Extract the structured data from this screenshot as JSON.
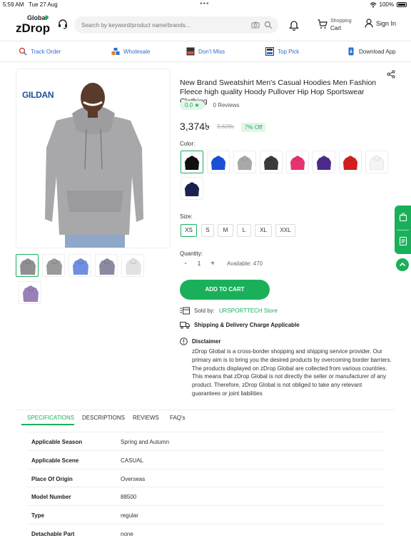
{
  "status_bar": {
    "time": "5:59 AM",
    "date": "Tue 27 Aug",
    "battery": "100%"
  },
  "header": {
    "logo_top": "Global",
    "logo_main": "zDrop",
    "search_placeholder": "Search by keyword/product name/brands...",
    "cart_line1": "Shopping",
    "cart_line2": "Cart",
    "signin": "Sign In"
  },
  "nav": [
    {
      "label": "Track Order",
      "icon": "track-order-icon"
    },
    {
      "label": "Wholesale",
      "icon": "wholesale-icon"
    },
    {
      "label": "Don't Miss",
      "icon": "best-price-icon"
    },
    {
      "label": "Top Pick",
      "icon": "top-pick-icon"
    },
    {
      "label": "Download App",
      "icon": "download-app-icon"
    }
  ],
  "product": {
    "brand_logo": "GILDAN",
    "title": "New Brand Sweatshirt Men's Casual Hoodies Men Fashion Fleece high quality Hoody Pullover Hip Hop Sportswear Clothing",
    "rating": "0.0",
    "reviews": "0 Reviews",
    "price": "3,374৳",
    "old_price": "3,628৳",
    "discount": "7% Off",
    "color_label": "Color:",
    "colors": [
      "#111111",
      "#1b4fd8",
      "#a9a9a9",
      "#3a3a3c",
      "#e8336e",
      "#4a2b8c",
      "#d21f1f",
      "#f4f4f4",
      "#1c2150"
    ],
    "size_label": "Size:",
    "sizes": [
      "XS",
      "S",
      "M",
      "L",
      "XL",
      "XXL"
    ],
    "selected_size": "XS",
    "quantity_label": "Quantity:",
    "quantity": "1",
    "minus": "-",
    "plus": "+",
    "available": "Available: 470",
    "add_to_cart": "ADD TO CART",
    "sold_by_label": "Sold by:",
    "store": "URSPORTTECH Store",
    "shipping": "Shipping & Delivery Charge Applicable",
    "disclaimer_title": "Disclaimer",
    "disclaimer_body": "zDrop Global is a cross-border shopping and shipping service provider. Our primary aim is to bring you the desired products by overcoming border barriers. The products displayed on zDrop Global are collected from various countries. This means that zDrop Global is not directly the seller or manufacturer of any product. Therefore, zDrop Global is not obliged to take any relevant guarantees or joint liabilities",
    "thumbnail_colors": [
      "#8f8f92",
      "#9a9a9a",
      "#6f8fe0",
      "#8a8aa0",
      "#e2e2e2",
      "#9a7fb8"
    ]
  },
  "tabs": [
    "SPECIFICATIONS",
    "DESCRIPTIONS",
    "REVIEWS",
    "FAQ's"
  ],
  "specs": [
    {
      "key": "Applicable Season",
      "value": "Spring and Autumn"
    },
    {
      "key": "Applicable Scene",
      "value": "CASUAL"
    },
    {
      "key": "Place Of Origin",
      "value": "Overseas"
    },
    {
      "key": "Model Number",
      "value": "88500"
    },
    {
      "key": "Type",
      "value": "regular"
    },
    {
      "key": "Detachable Part",
      "value": "none"
    }
  ],
  "accent_color": "#1ab05a"
}
